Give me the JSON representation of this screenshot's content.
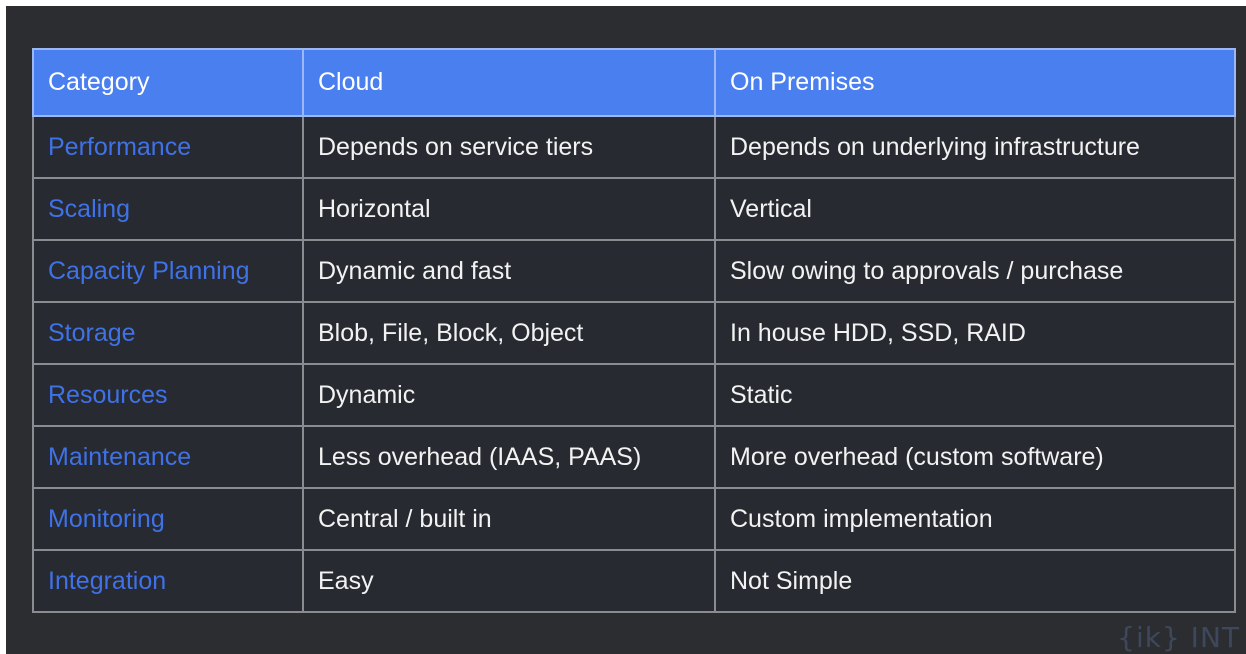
{
  "table": {
    "headers": [
      "Category",
      "Cloud",
      "On Premises"
    ],
    "rows": [
      [
        "Performance",
        "Depends on service tiers",
        "Depends on underlying infrastructure"
      ],
      [
        "Scaling",
        "Horizontal",
        "Vertical"
      ],
      [
        "Capacity Planning",
        "Dynamic and fast",
        "Slow owing to approvals / purchase"
      ],
      [
        "Storage",
        "Blob, File, Block, Object",
        "In house HDD, SSD, RAID"
      ],
      [
        "Resources",
        "Dynamic",
        "Static"
      ],
      [
        "Maintenance",
        "Less overhead (IAAS, PAAS)",
        "More overhead (custom software)"
      ],
      [
        "Monitoring",
        "Central / built in",
        "Custom implementation"
      ],
      [
        "Integration",
        "Easy",
        "Not Simple"
      ]
    ]
  },
  "colors": {
    "slide_background": "#2b2d31",
    "header_background": "#4a7ff0",
    "category_text": "#3f72e8",
    "body_text": "#f2f2f2"
  },
  "watermark": {
    "text": "{ik} INT"
  }
}
